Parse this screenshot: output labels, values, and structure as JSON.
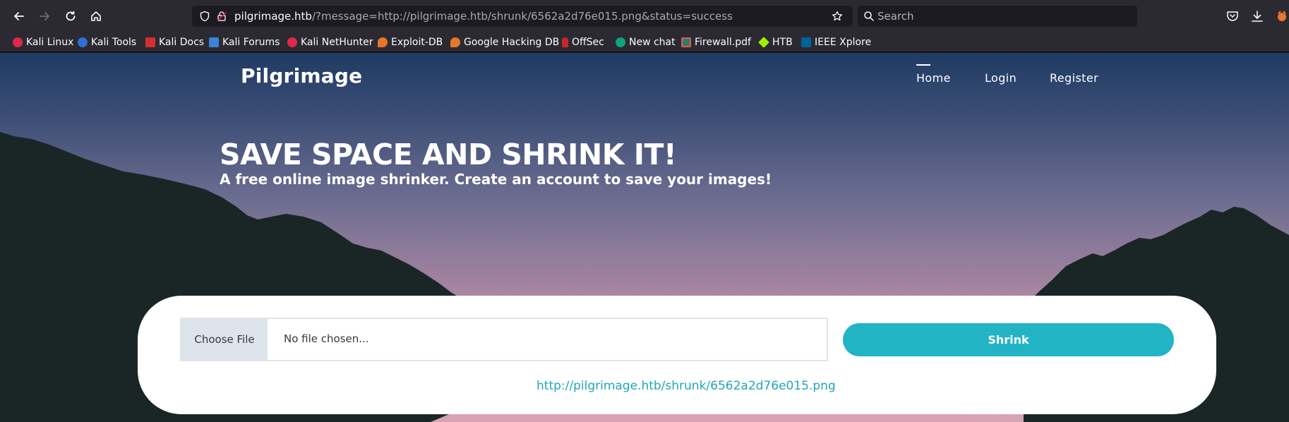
{
  "browser": {
    "url_host": "pilgrimage.htb",
    "url_rest": "/?message=http://pilgrimage.htb/shrunk/6562a2d76e015.png&status=success",
    "search_placeholder": "Search",
    "bookmarks": [
      {
        "label": "Kali Linux",
        "icon": "kali-icon",
        "color": "#e0284a"
      },
      {
        "label": "Kali Tools",
        "icon": "kali-tools-icon",
        "color": "#2f6fd6"
      },
      {
        "label": "Kali Docs",
        "icon": "kali-docs-icon",
        "color": "#d32f2f"
      },
      {
        "label": "Kali Forums",
        "icon": "kali-forums-icon",
        "color": "#3b82d6"
      },
      {
        "label": "Kali NetHunter",
        "icon": "nethunter-icon",
        "color": "#e0284a"
      },
      {
        "label": "Exploit-DB",
        "icon": "exploit-db-icon",
        "color": "#e5762a"
      },
      {
        "label": "Google Hacking DB",
        "icon": "ghdb-icon",
        "color": "#e5762a"
      },
      {
        "label": "OffSec",
        "icon": "offsec-icon",
        "color": "#c62828"
      },
      {
        "label": "New chat",
        "icon": "chat-icon",
        "color": "#10a37f"
      },
      {
        "label": "Firewall.pdf",
        "icon": "pdf-icon",
        "color": "#2e7d6a"
      },
      {
        "label": "HTB",
        "icon": "htb-icon",
        "color": "#9fef00"
      },
      {
        "label": "IEEE Xplore",
        "icon": "ieee-icon",
        "color": "#00629b"
      }
    ]
  },
  "page": {
    "brand": "Pilgrimage",
    "nav": [
      "Home",
      "Login",
      "Register"
    ],
    "hero_title": "SAVE SPACE AND SHRINK IT!",
    "hero_subtitle": "A free online image shrinker. Create an account to save your images!",
    "choose_file_label": "Choose File",
    "file_status": "No file chosen...",
    "shrink_label": "Shrink",
    "result_link": "http://pilgrimage.htb/shrunk/6562a2d76e015.png"
  },
  "colors": {
    "accent": "#22b4c4",
    "link": "#22a6b8",
    "chrome": "#2b2a33"
  }
}
